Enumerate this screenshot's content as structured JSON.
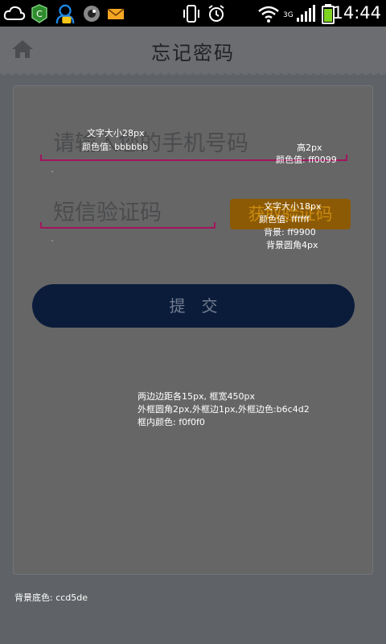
{
  "status_bar": {
    "time": "14:44",
    "network_label": "3G",
    "icons": [
      "cloud-icon",
      "app-icon",
      "user-icon",
      "message-icon",
      "camera-icon",
      "mail-icon",
      "vibrate-icon",
      "alarm-icon",
      "wifi-icon",
      "signal-icon",
      "battery-icon"
    ]
  },
  "header": {
    "title": "忘记密码",
    "home_icon": "home-icon"
  },
  "form": {
    "phone_placeholder": "请输入您的手机号码",
    "code_placeholder": "短信验证码",
    "get_code_label": "获取验证码",
    "submit_label": "提交"
  },
  "annotations": {
    "input_text_size": "文字大小28px",
    "input_text_color": "颜色值: bbbbbb",
    "line_height": "高2px",
    "line_color": "颜色值: ff0099",
    "btn_text_size": "文字大小18px",
    "btn_text_color": "颜色值: ffffff",
    "btn_bg": "背景: ff9900",
    "btn_radius": "背景圆角4px",
    "frame_margin": "两边边距各15px, 框宽450px",
    "frame_border": "外框圆角2px,外框边1px,外框边色:b6c4d2",
    "frame_inner": "框内颜色: f0f0f0",
    "page_bg": "背景底色: ccd5de"
  },
  "colors": {
    "accent_line": "#ff0099",
    "button_orange": "#ff9900",
    "submit_blue": "#0b1c3b"
  }
}
